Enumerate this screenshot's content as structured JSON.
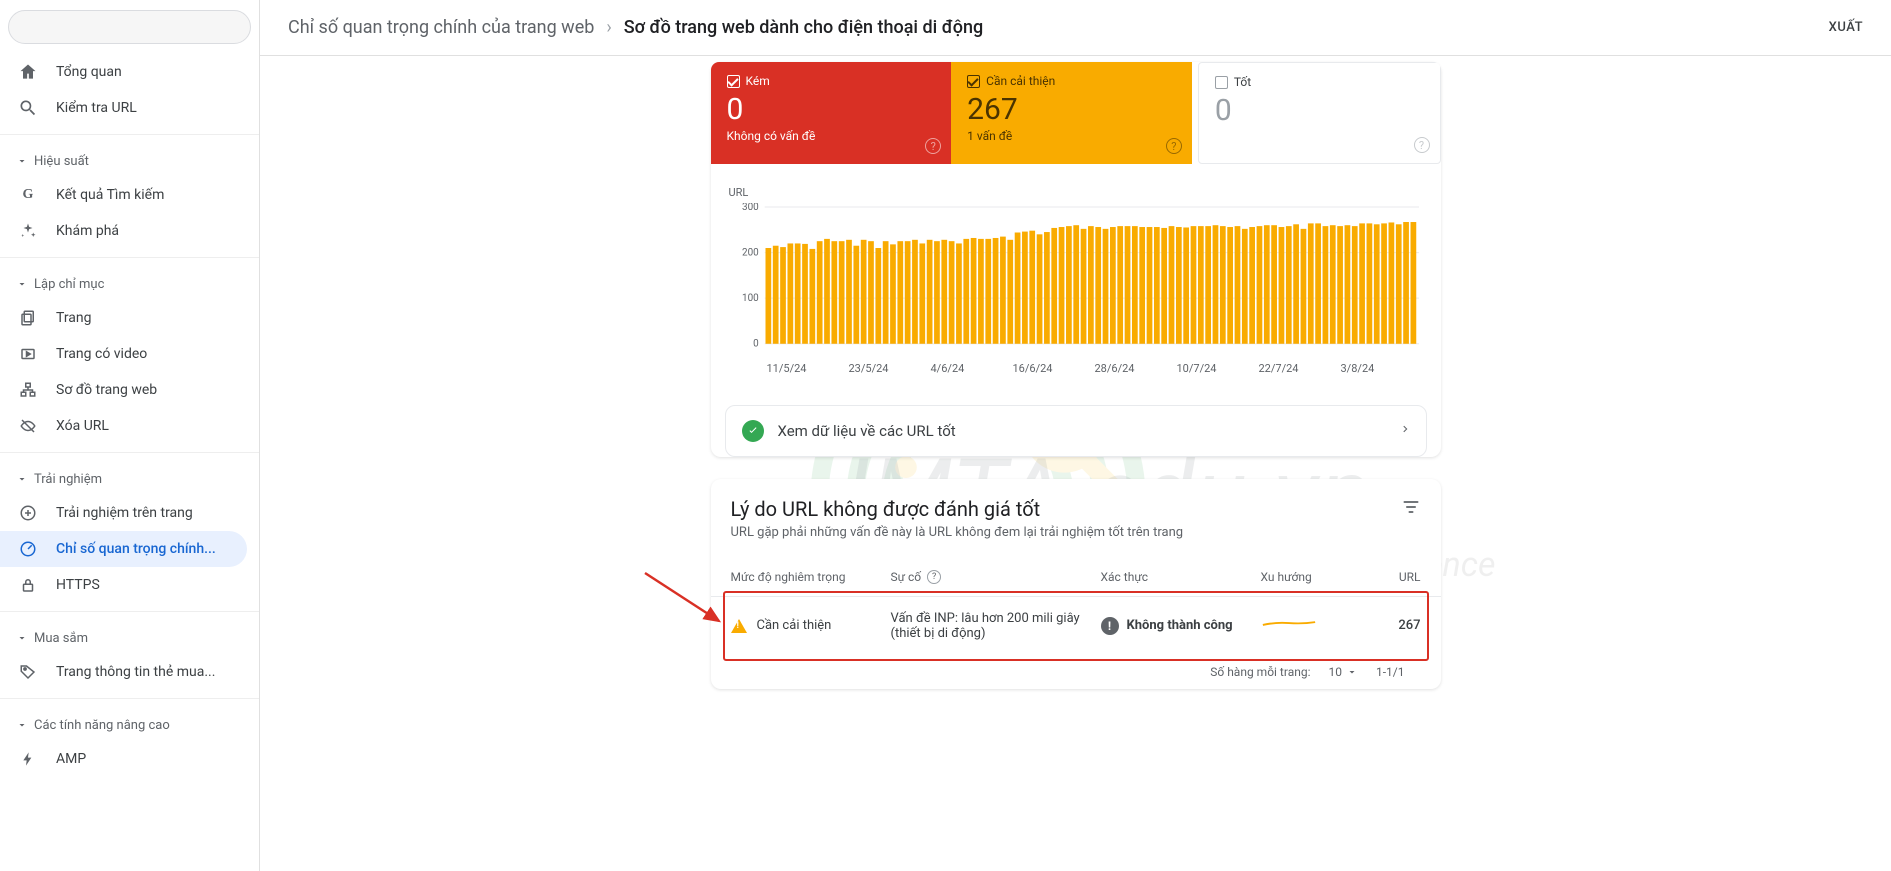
{
  "breadcrumb": {
    "parent": "Chỉ số quan trọng chính của trang web",
    "current": "Sơ đồ trang web dành cho điện thoại di động"
  },
  "export_label": "XUẤT",
  "sidebar": {
    "items": [
      {
        "label": "Tổng quan"
      },
      {
        "label": "Kiểm tra URL"
      }
    ],
    "groups": [
      {
        "title": "Hiệu suất",
        "items": [
          {
            "label": "Kết quả Tìm kiếm"
          },
          {
            "label": "Khám phá"
          }
        ]
      },
      {
        "title": "Lập chỉ mục",
        "items": [
          {
            "label": "Trang"
          },
          {
            "label": "Trang có video"
          },
          {
            "label": "Sơ đồ trang web"
          },
          {
            "label": "Xóa URL"
          }
        ]
      },
      {
        "title": "Trải nghiệm",
        "items": [
          {
            "label": "Trải nghiệm trên trang"
          },
          {
            "label": "Chỉ số quan trọng chính..."
          },
          {
            "label": "HTTPS"
          }
        ]
      },
      {
        "title": "Mua sắm",
        "items": [
          {
            "label": "Trang thông tin thẻ mua..."
          }
        ]
      },
      {
        "title": "Các tính năng nâng cao",
        "items": [
          {
            "label": "AMP"
          }
        ]
      }
    ]
  },
  "status": {
    "poor": {
      "label": "Kém",
      "value": "0",
      "sub": "Không có vấn đề"
    },
    "improve": {
      "label": "Cần cải thiện",
      "value": "267",
      "sub": "1 vấn đề"
    },
    "good": {
      "label": "Tốt",
      "value": "0",
      "sub": ""
    }
  },
  "good_link_label": "Xem dữ liệu về các URL tốt",
  "reasons": {
    "title": "Lý do URL không được đánh giá tốt",
    "subtitle": "URL gặp phải những vấn đề này là URL không đem lại trải nghiệm tốt trên trang",
    "columns": {
      "severity": "Mức độ nghiêm trọng",
      "issue": "Sự cố",
      "validation": "Xác thực",
      "trend": "Xu hướng",
      "url": "URL"
    },
    "row": {
      "severity": "Cần cải thiện",
      "issue": "Vấn đề INP: lâu hơn 200 mili giây (thiết bị di động)",
      "validation": "Không thành công",
      "url_count": "267"
    }
  },
  "pager": {
    "label": "Số hàng mỗi trang:",
    "per": "10",
    "range": "1-1/1"
  },
  "watermark": {
    "line1": "IMTA.edu.vn",
    "line2": "Internet Marketing Target Audience"
  },
  "chart_data": {
    "type": "bar",
    "title": "",
    "xlabel": "",
    "ylabel": "URL",
    "ylim": [
      0,
      300
    ],
    "yticks": [
      0,
      100,
      200,
      300
    ],
    "categories": [
      "11/5/24",
      "12/5/24",
      "13/5/24",
      "14/5/24",
      "15/5/24",
      "16/5/24",
      "17/5/24",
      "18/5/24",
      "19/5/24",
      "20/5/24",
      "21/5/24",
      "22/5/24",
      "23/5/24",
      "24/5/24",
      "25/5/24",
      "26/5/24",
      "27/5/24",
      "28/5/24",
      "29/5/24",
      "30/5/24",
      "31/5/24",
      "1/6/24",
      "2/6/24",
      "3/6/24",
      "4/6/24",
      "5/6/24",
      "6/6/24",
      "7/6/24",
      "8/6/24",
      "9/6/24",
      "10/6/24",
      "11/6/24",
      "12/6/24",
      "13/6/24",
      "14/6/24",
      "15/6/24",
      "16/6/24",
      "17/6/24",
      "18/6/24",
      "19/6/24",
      "20/6/24",
      "21/6/24",
      "22/6/24",
      "23/6/24",
      "24/6/24",
      "25/6/24",
      "26/6/24",
      "27/6/24",
      "28/6/24",
      "29/6/24",
      "30/6/24",
      "1/7/24",
      "2/7/24",
      "3/7/24",
      "4/7/24",
      "5/7/24",
      "6/7/24",
      "7/7/24",
      "8/7/24",
      "9/7/24",
      "10/7/24",
      "11/7/24",
      "12/7/24",
      "13/7/24",
      "14/7/24",
      "15/7/24",
      "16/7/24",
      "17/7/24",
      "18/7/24",
      "19/7/24",
      "20/7/24",
      "21/7/24",
      "22/7/24",
      "23/7/24",
      "24/7/24",
      "25/7/24",
      "26/7/24",
      "27/7/24",
      "28/7/24",
      "29/7/24",
      "30/7/24",
      "31/7/24",
      "1/8/24",
      "2/8/24",
      "3/8/24",
      "4/8/24",
      "5/8/24",
      "6/8/24",
      "7/8/24"
    ],
    "x_tick_labels": [
      "11/5/24",
      "23/5/24",
      "4/6/24",
      "16/6/24",
      "28/6/24",
      "10/7/24",
      "22/7/24",
      "3/8/24"
    ],
    "series": [
      {
        "name": "Cần cải thiện",
        "color": "#f9ab00",
        "values": [
          210,
          215,
          212,
          220,
          220,
          219,
          208,
          225,
          230,
          225,
          225,
          228,
          215,
          228,
          225,
          210,
          225,
          218,
          225,
          225,
          228,
          220,
          228,
          225,
          228,
          225,
          220,
          230,
          232,
          230,
          230,
          232,
          235,
          228,
          244,
          246,
          248,
          240,
          245,
          254,
          256,
          258,
          260,
          252,
          258,
          256,
          252,
          256,
          258,
          258,
          258,
          256,
          256,
          256,
          254,
          258,
          256,
          255,
          258,
          258,
          258,
          260,
          258,
          256,
          258,
          252,
          256,
          258,
          260,
          260,
          256,
          258,
          262,
          252,
          264,
          264,
          258,
          260,
          258,
          260,
          258,
          264,
          264,
          262,
          264,
          266,
          262,
          267,
          267
        ]
      },
      {
        "name": "Kém",
        "color": "#d93025",
        "values": [
          0,
          0,
          0,
          0,
          0,
          0,
          0,
          0,
          0,
          0,
          0,
          0,
          0,
          0,
          0,
          0,
          0,
          0,
          0,
          0,
          0,
          0,
          0,
          0,
          0,
          0,
          0,
          0,
          0,
          0,
          0,
          0,
          0,
          0,
          0,
          0,
          0,
          0,
          0,
          0,
          0,
          0,
          0,
          0,
          0,
          0,
          0,
          0,
          0,
          0,
          0,
          0,
          0,
          0,
          0,
          0,
          0,
          0,
          0,
          0,
          0,
          0,
          0,
          0,
          0,
          0,
          0,
          0,
          0,
          0,
          0,
          0,
          0,
          0,
          0,
          0,
          0,
          0,
          0,
          0,
          0,
          0,
          0,
          0,
          0,
          0,
          0,
          0,
          0
        ]
      },
      {
        "name": "Tốt",
        "color": "#34a853",
        "values": [
          0,
          0,
          0,
          0,
          0,
          0,
          0,
          0,
          0,
          0,
          0,
          0,
          0,
          0,
          0,
          0,
          0,
          0,
          0,
          0,
          0,
          0,
          0,
          0,
          0,
          0,
          0,
          0,
          0,
          0,
          0,
          0,
          0,
          0,
          0,
          0,
          0,
          0,
          0,
          0,
          0,
          0,
          0,
          0,
          0,
          0,
          0,
          0,
          0,
          0,
          0,
          0,
          0,
          0,
          0,
          0,
          0,
          0,
          0,
          0,
          0,
          0,
          0,
          0,
          0,
          0,
          0,
          0,
          0,
          0,
          0,
          0,
          0,
          0,
          0,
          0,
          0,
          0,
          0,
          0,
          0,
          0,
          0,
          0,
          0,
          0,
          0,
          0,
          0
        ]
      }
    ]
  }
}
